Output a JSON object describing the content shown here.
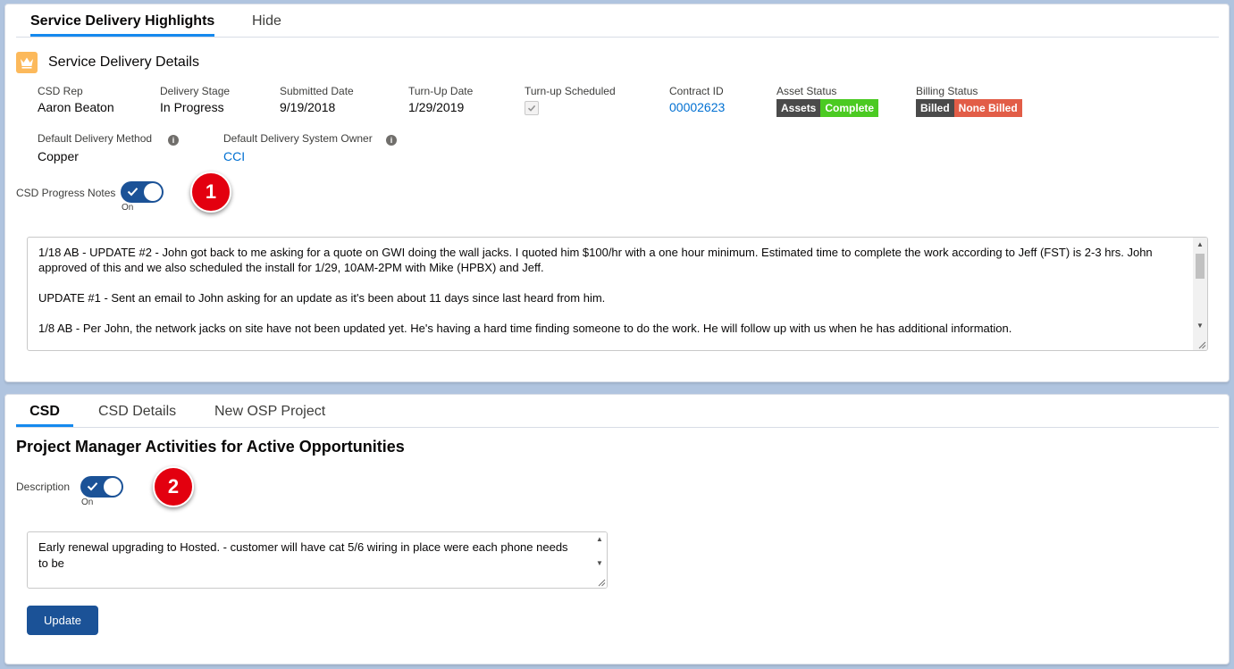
{
  "top_tabs": [
    {
      "label": "Service Delivery Highlights",
      "active": true
    },
    {
      "label": "Hide",
      "active": false
    }
  ],
  "details": {
    "title": "Service Delivery Details",
    "icon": "crown-icon",
    "fields": {
      "csd_rep": {
        "label": "CSD Rep",
        "value": "Aaron Beaton"
      },
      "delivery_stage": {
        "label": "Delivery Stage",
        "value": "In Progress"
      },
      "submitted_date": {
        "label": "Submitted Date",
        "value": "9/19/2018"
      },
      "turn_up_date": {
        "label": "Turn-Up Date",
        "value": "1/29/2019"
      },
      "turn_up_scheduled": {
        "label": "Turn-up Scheduled",
        "checked": true
      },
      "contract_id": {
        "label": "Contract ID",
        "value": "00002623"
      },
      "asset_status": {
        "label": "Asset Status",
        "badge_left": "Assets",
        "badge_right": "Complete"
      },
      "billing_status": {
        "label": "Billing Status",
        "badge_left": "Billed",
        "badge_right": "None Billed"
      },
      "default_delivery_method": {
        "label": "Default Delivery Method",
        "value": "Copper"
      },
      "default_delivery_system_owner": {
        "label": "Default Delivery System Owner",
        "value": "CCI"
      }
    }
  },
  "progress_notes_toggle": {
    "label": "CSD Progress Notes",
    "state": "On"
  },
  "marker1": "1",
  "progress_notes": {
    "paragraphs": [
      "1/18 AB - UPDATE #2 - John got back to me asking for a quote on GWI doing the wall jacks. I quoted him $100/hr with a one hour minimum. Estimated time to complete the work according to Jeff (FST) is 2-3 hrs. John approved of this and we also scheduled the install for 1/29, 10AM-2PM with Mike (HPBX) and Jeff.",
      "UPDATE #1 - Sent an email to John asking for an update as it's been about 11 days since last heard from him.",
      "1/8 AB - Per John, the network jacks on site have not been updated yet. He's having a hard time finding someone to do the work. He will follow up with us when he has additional information."
    ]
  },
  "bottom_tabs": [
    {
      "label": "CSD",
      "active": true
    },
    {
      "label": "CSD Details",
      "active": false
    },
    {
      "label": "New OSP Project",
      "active": false
    }
  ],
  "pm_title": "Project Manager Activities for Active Opportunities",
  "description_toggle": {
    "label": "Description",
    "state": "On"
  },
  "marker2": "2",
  "description_text": "Early renewal upgrading to Hosted. - customer will have cat 5/6 wiring in place were each phone needs to be",
  "update_button": "Update",
  "colors": {
    "accent": "#1b5297",
    "tab_underline": "#1589ee",
    "link": "#0070d2",
    "badge_green": "#4bca22",
    "badge_red": "#e25d47",
    "badge_dark": "#4a4a4a",
    "marker_red": "#e3000f"
  }
}
